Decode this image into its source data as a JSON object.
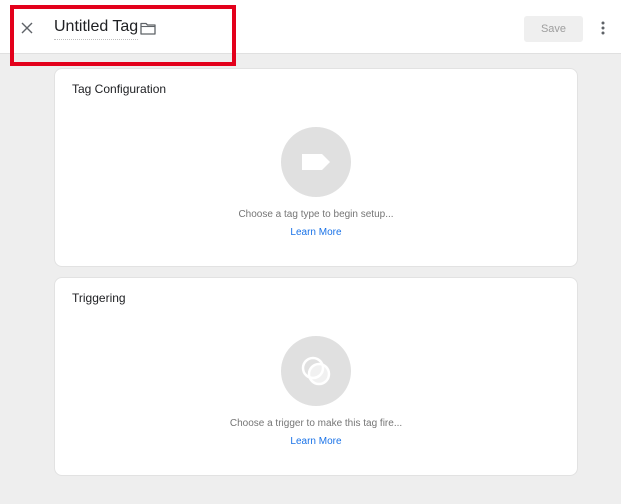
{
  "header": {
    "close_icon": "close-icon",
    "tag_name": "Untitled Tag",
    "folder_icon": "folder-icon",
    "save_label": "Save",
    "more_icon": "more-vert-icon"
  },
  "tag_configuration": {
    "title": "Tag Configuration",
    "icon": "tag-icon",
    "hint": "Choose a tag type to begin setup...",
    "link": "Learn More"
  },
  "triggering": {
    "title": "Triggering",
    "icon": "trigger-icon",
    "hint": "Choose a trigger to make this tag fire...",
    "link": "Learn More"
  },
  "colors": {
    "highlight": "#e3001b",
    "link": "#1a73e8",
    "background": "#eeeeee",
    "placeholder": "#e0e0e0"
  }
}
